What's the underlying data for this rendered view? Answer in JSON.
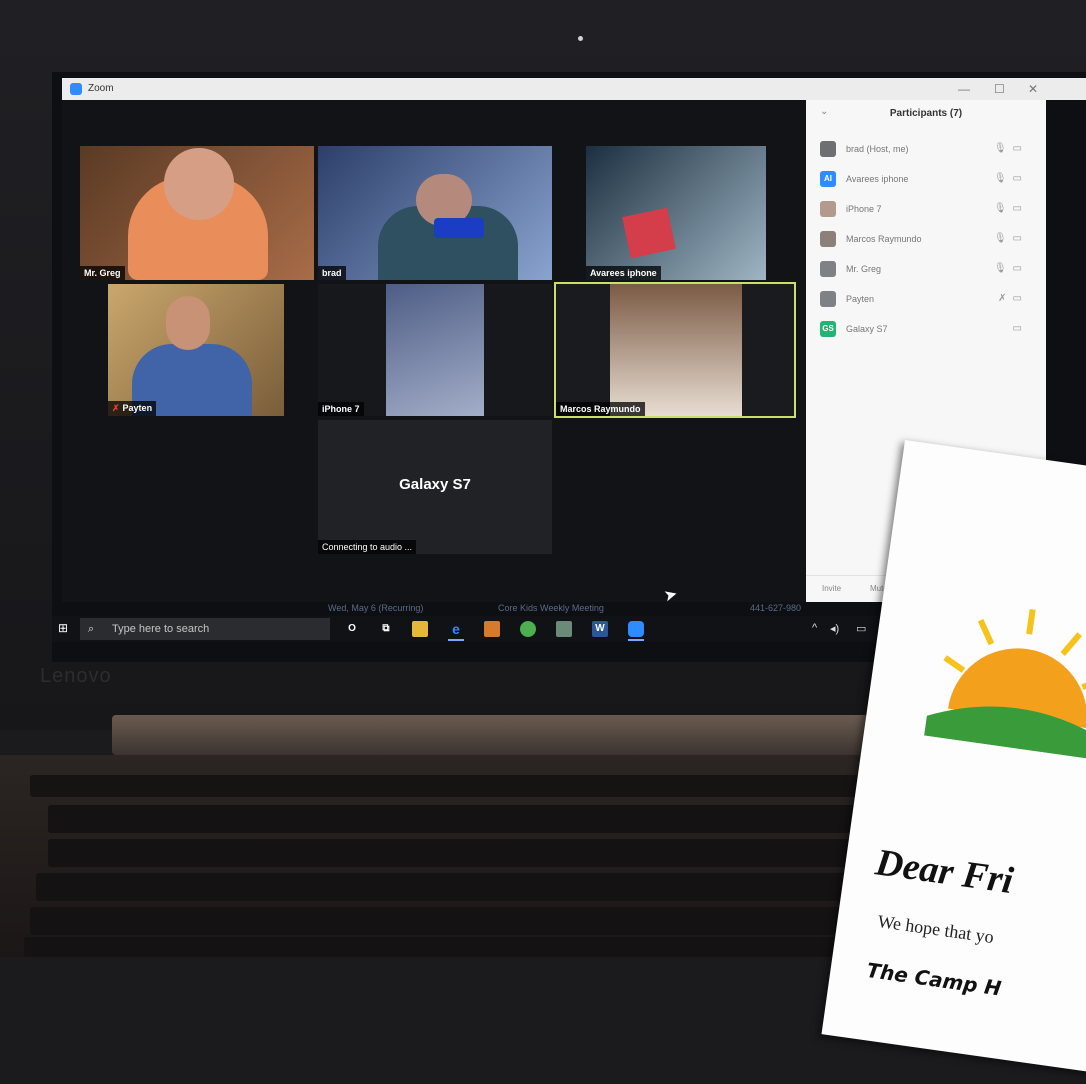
{
  "window": {
    "title": "Zoom",
    "minimize": "—",
    "maximize": "☐",
    "close": "✕"
  },
  "tiles": [
    {
      "name": "Mr. Greg"
    },
    {
      "name": "brad"
    },
    {
      "name": "Avarees iphone"
    },
    {
      "name": "Payten"
    },
    {
      "name": "iPhone 7"
    },
    {
      "name": "Marcos Raymundo"
    },
    {
      "name": "Galaxy S7",
      "status": "Connecting to audio ..."
    }
  ],
  "participants": {
    "title": "Participants (7)",
    "items": [
      {
        "name": "brad (Host, me)",
        "avatar": ""
      },
      {
        "name": "Avarees iphone",
        "avatar": "AI"
      },
      {
        "name": "iPhone 7",
        "avatar": ""
      },
      {
        "name": "Marcos Raymundo",
        "avatar": ""
      },
      {
        "name": "Mr. Greg",
        "avatar": ""
      },
      {
        "name": "Payten",
        "avatar": ""
      },
      {
        "name": "Galaxy S7",
        "avatar": "GS"
      }
    ],
    "invite": "Invite",
    "mute": "Mute"
  },
  "meeting_bar": {
    "date": "Wed, May 6 (Recurring)",
    "topic": "Core Kids Weekly Meeting",
    "phone": "441-627-980"
  },
  "taskbar": {
    "search_placeholder": "Type here to search"
  },
  "laptop": {
    "brand": "Lenovo"
  },
  "letter": {
    "heading": "Dear Fri",
    "body": "We hope that yo",
    "sub": "The Camp H"
  },
  "colors": {
    "zoom_blue": "#2d8cff",
    "active_speaker": "#c8e06a",
    "muted_red": "#e23b3b"
  }
}
